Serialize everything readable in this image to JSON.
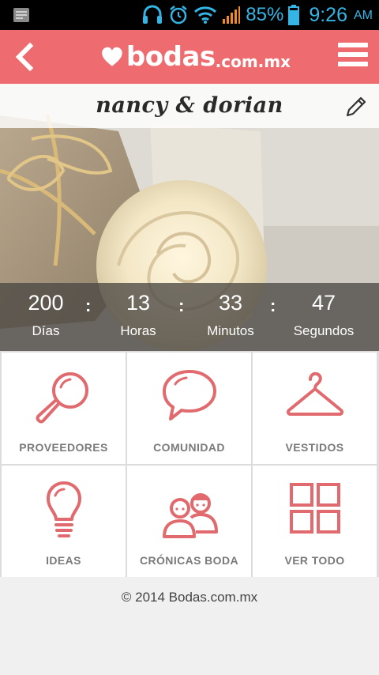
{
  "status_bar": {
    "battery_percent": "85%",
    "time": "9:26",
    "ampm": "AM",
    "icons": [
      "notification-icon",
      "headset-icon",
      "alarm-icon",
      "wifi-icon",
      "signal-icon",
      "battery-icon"
    ],
    "color": "#33b5e5"
  },
  "header": {
    "logo_text": "bodas",
    "logo_tld": ".com.mx",
    "accent_color": "#ee6b6f",
    "back_icon": "chevron-left-icon",
    "menu_icon": "hamburger-menu-icon"
  },
  "hero": {
    "couple_name": "nancy & dorian",
    "edit_icon": "pencil-icon"
  },
  "countdown": {
    "dias": "200",
    "dias_label": "Días",
    "horas": "13",
    "horas_label": "Horas",
    "minutos": "33",
    "minutos_label": "Minutos",
    "segundos": "47",
    "segundos_label": "Segundos",
    "separator": ":"
  },
  "menu_tiles": [
    {
      "label": "PROVEEDORES",
      "icon": "magnifier-icon"
    },
    {
      "label": "COMUNIDAD",
      "icon": "speech-bubble-icon"
    },
    {
      "label": "VESTIDOS",
      "icon": "hanger-icon"
    },
    {
      "label": "IDEAS",
      "icon": "lightbulb-icon"
    },
    {
      "label": "CRÓNICAS BODA",
      "icon": "couple-icon"
    },
    {
      "label": "VER TODO",
      "icon": "grid-icon"
    }
  ],
  "footer": {
    "copyright": "© 2014 Bodas.com.mx"
  }
}
